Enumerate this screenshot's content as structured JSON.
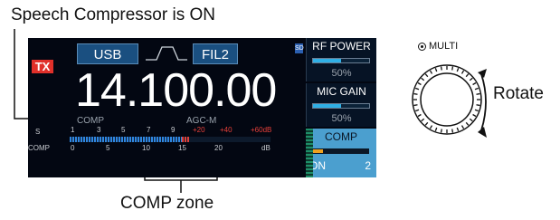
{
  "callouts": {
    "speech_compressor": "Speech Compressor is ON",
    "comp_zone": "COMP zone",
    "multi_label": "MULTI",
    "rotate": "Rotate"
  },
  "screen": {
    "mode_button": "USB",
    "filter_button": "FIL2",
    "sd_badge": "SD",
    "tx_indicator": "TX",
    "frequency": "14.100.00",
    "comp_status": "COMP",
    "agc_status": "AGC-M",
    "s_meter_label": "S",
    "s_ticks": [
      "1",
      "3",
      "5",
      "7",
      "9"
    ],
    "s_plus_ticks": [
      "+20",
      "+40",
      "+60dB"
    ],
    "comp_meter_label": "COMP",
    "comp_ticks": [
      "0",
      "5",
      "10",
      "15",
      "20",
      "dB"
    ],
    "s_meter_level": 0.6,
    "panels": {
      "rf_power": {
        "title": "RF POWER",
        "value": "50%",
        "level": 0.5
      },
      "mic_gain": {
        "title": "MIC GAIN",
        "value": "50%",
        "level": 0.5
      },
      "comp": {
        "title": "COMP",
        "state": "ON",
        "value": "2",
        "level": 0.2
      }
    }
  },
  "colors": {
    "screen_bg": "#030712",
    "accent_blue": "#2fb0e6",
    "tx_red": "#e0302a",
    "comp_panel": "#4b9fcf"
  }
}
